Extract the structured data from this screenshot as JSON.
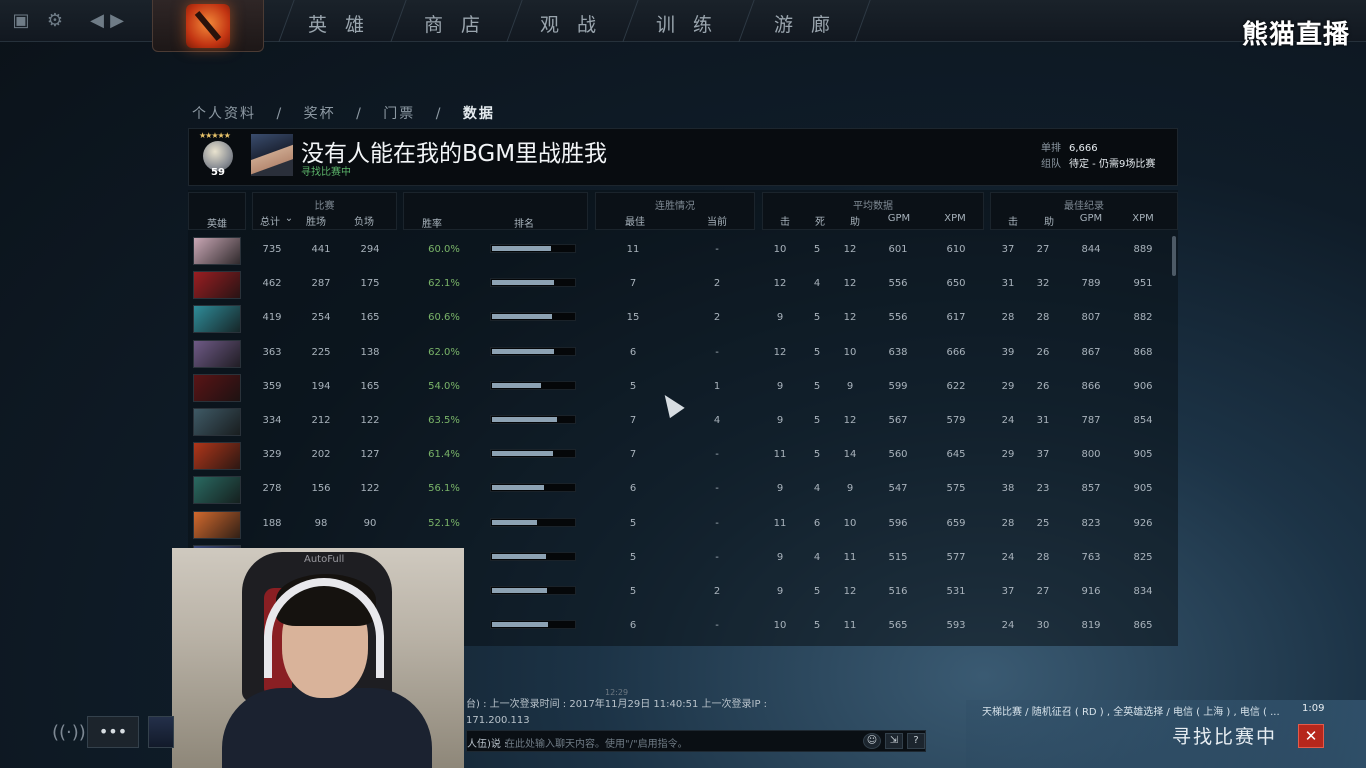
{
  "nav": {
    "tabs": [
      "英 雄",
      "商 店",
      "观 战",
      "训 练",
      "游 廊"
    ],
    "brand": "熊猫直播"
  },
  "breadcrumb": [
    "个人资料",
    "/",
    "奖杯",
    "/",
    "门票",
    "/",
    "数据"
  ],
  "profile": {
    "name": "没有人能在我的BGM里战胜我",
    "status": "寻找比赛中",
    "medal_level": "59",
    "solo_label": "单排",
    "solo_value": "6,666",
    "party_label": "组队",
    "party_value": "待定 - 仍需9场比赛"
  },
  "table": {
    "groups": {
      "match": "比赛",
      "streak": "连胜情况",
      "average": "平均数据",
      "best": "最佳纪录"
    },
    "columns": {
      "hero": "英雄",
      "total": "总计",
      "wins": "胜场",
      "losses": "负场",
      "winrate": "胜率",
      "rank": "排名",
      "streak_best": "最佳",
      "streak_current": "当前",
      "avg_kills": "击",
      "avg_deaths": "死",
      "avg_assists": "助",
      "avg_gpm": "GPM",
      "avg_xpm": "XPM",
      "best_kills": "击",
      "best_assists": "助",
      "best_gpm": "GPM",
      "best_xpm": "XPM"
    },
    "rows": [
      {
        "total": "735",
        "wins": "441",
        "losses": "294",
        "winrate": "60.0%",
        "rank": 0.7,
        "streak_best": "11",
        "streak_current": "-",
        "k": "10",
        "d": "5",
        "a": "12",
        "gpm": "601",
        "xpm": "610",
        "bk": "37",
        "ba": "27",
        "bgpm": "844",
        "bxpm": "889",
        "hero_color": "#c9a7b5"
      },
      {
        "total": "462",
        "wins": "287",
        "losses": "175",
        "winrate": "62.1%",
        "rank": 0.74,
        "streak_best": "7",
        "streak_current": "2",
        "k": "12",
        "d": "4",
        "a": "12",
        "gpm": "556",
        "xpm": "650",
        "bk": "31",
        "ba": "32",
        "bgpm": "789",
        "bxpm": "951",
        "hero_color": "#9a1e22"
      },
      {
        "total": "419",
        "wins": "254",
        "losses": "165",
        "winrate": "60.6%",
        "rank": 0.71,
        "streak_best": "15",
        "streak_current": "2",
        "k": "9",
        "d": "5",
        "a": "12",
        "gpm": "556",
        "xpm": "617",
        "bk": "28",
        "ba": "28",
        "bgpm": "807",
        "bxpm": "882",
        "hero_color": "#2f8c99"
      },
      {
        "total": "363",
        "wins": "225",
        "losses": "138",
        "winrate": "62.0%",
        "rank": 0.74,
        "streak_best": "6",
        "streak_current": "-",
        "k": "12",
        "d": "5",
        "a": "10",
        "gpm": "638",
        "xpm": "666",
        "bk": "39",
        "ba": "26",
        "bgpm": "867",
        "bxpm": "868",
        "hero_color": "#6e5a86"
      },
      {
        "total": "359",
        "wins": "194",
        "losses": "165",
        "winrate": "54.0%",
        "rank": 0.58,
        "streak_best": "5",
        "streak_current": "1",
        "k": "9",
        "d": "5",
        "a": "9",
        "gpm": "599",
        "xpm": "622",
        "bk": "29",
        "ba": "26",
        "bgpm": "866",
        "bxpm": "906",
        "hero_color": "#5a1416"
      },
      {
        "total": "334",
        "wins": "212",
        "losses": "122",
        "winrate": "63.5%",
        "rank": 0.77,
        "streak_best": "7",
        "streak_current": "4",
        "k": "9",
        "d": "5",
        "a": "12",
        "gpm": "567",
        "xpm": "579",
        "bk": "24",
        "ba": "31",
        "bgpm": "787",
        "bxpm": "854",
        "hero_color": "#3f5a66"
      },
      {
        "total": "329",
        "wins": "202",
        "losses": "127",
        "winrate": "61.4%",
        "rank": 0.73,
        "streak_best": "7",
        "streak_current": "-",
        "k": "11",
        "d": "5",
        "a": "14",
        "gpm": "560",
        "xpm": "645",
        "bk": "29",
        "ba": "37",
        "bgpm": "800",
        "bxpm": "905",
        "hero_color": "#b0361a"
      },
      {
        "total": "278",
        "wins": "156",
        "losses": "122",
        "winrate": "56.1%",
        "rank": 0.62,
        "streak_best": "6",
        "streak_current": "-",
        "k": "9",
        "d": "4",
        "a": "9",
        "gpm": "547",
        "xpm": "575",
        "bk": "38",
        "ba": "23",
        "bgpm": "857",
        "bxpm": "905",
        "hero_color": "#2a6a62"
      },
      {
        "total": "188",
        "wins": "98",
        "losses": "90",
        "winrate": "52.1%",
        "rank": 0.53,
        "streak_best": "5",
        "streak_current": "-",
        "k": "11",
        "d": "6",
        "a": "10",
        "gpm": "596",
        "xpm": "659",
        "bk": "28",
        "ba": "25",
        "bgpm": "823",
        "bxpm": "926",
        "hero_color": "#d2692e"
      },
      {
        "total": "",
        "wins": "",
        "losses": "",
        "winrate": "",
        "rank": 0.64,
        "streak_best": "5",
        "streak_current": "-",
        "k": "9",
        "d": "4",
        "a": "11",
        "gpm": "515",
        "xpm": "577",
        "bk": "24",
        "ba": "28",
        "bgpm": "763",
        "bxpm": "825",
        "hero_color": "#3b4a7a"
      },
      {
        "total": "",
        "wins": "",
        "losses": "",
        "winrate": "",
        "rank": 0.66,
        "streak_best": "5",
        "streak_current": "2",
        "k": "9",
        "d": "5",
        "a": "12",
        "gpm": "516",
        "xpm": "531",
        "bk": "37",
        "ba": "27",
        "bgpm": "916",
        "bxpm": "834",
        "hero_color": "#2b3440"
      },
      {
        "total": "",
        "wins": "",
        "losses": "",
        "winrate": "",
        "rank": 0.67,
        "streak_best": "6",
        "streak_current": "-",
        "k": "10",
        "d": "5",
        "a": "11",
        "gpm": "565",
        "xpm": "593",
        "bk": "24",
        "ba": "30",
        "bgpm": "819",
        "bxpm": "865",
        "hero_color": "#2b3440"
      }
    ]
  },
  "webcam": {
    "brand_text": "AutoFull"
  },
  "chat": {
    "time": "12:29",
    "line1": "台) : 上一次登录时间 : 2017年11月29日 11:40:51 上一次登录IP :",
    "line2": "171.200.113",
    "channel_label": "人伍)说 :",
    "placeholder": "在此处输入聊天内容。使用\"/\"启用指令。",
    "help": "?"
  },
  "matchmaking": {
    "info": "天梯比赛 / 随机征召 ( RD ) , 全英雄选择 / 电信 ( 上海 ) , 电信 ( ...",
    "time": "1:09",
    "title": "寻找比赛中",
    "close": "✕"
  },
  "icons": {
    "party": "•••",
    "broadcast": "((·))",
    "settings": "⚙",
    "back": "◀",
    "forward": "▶"
  }
}
